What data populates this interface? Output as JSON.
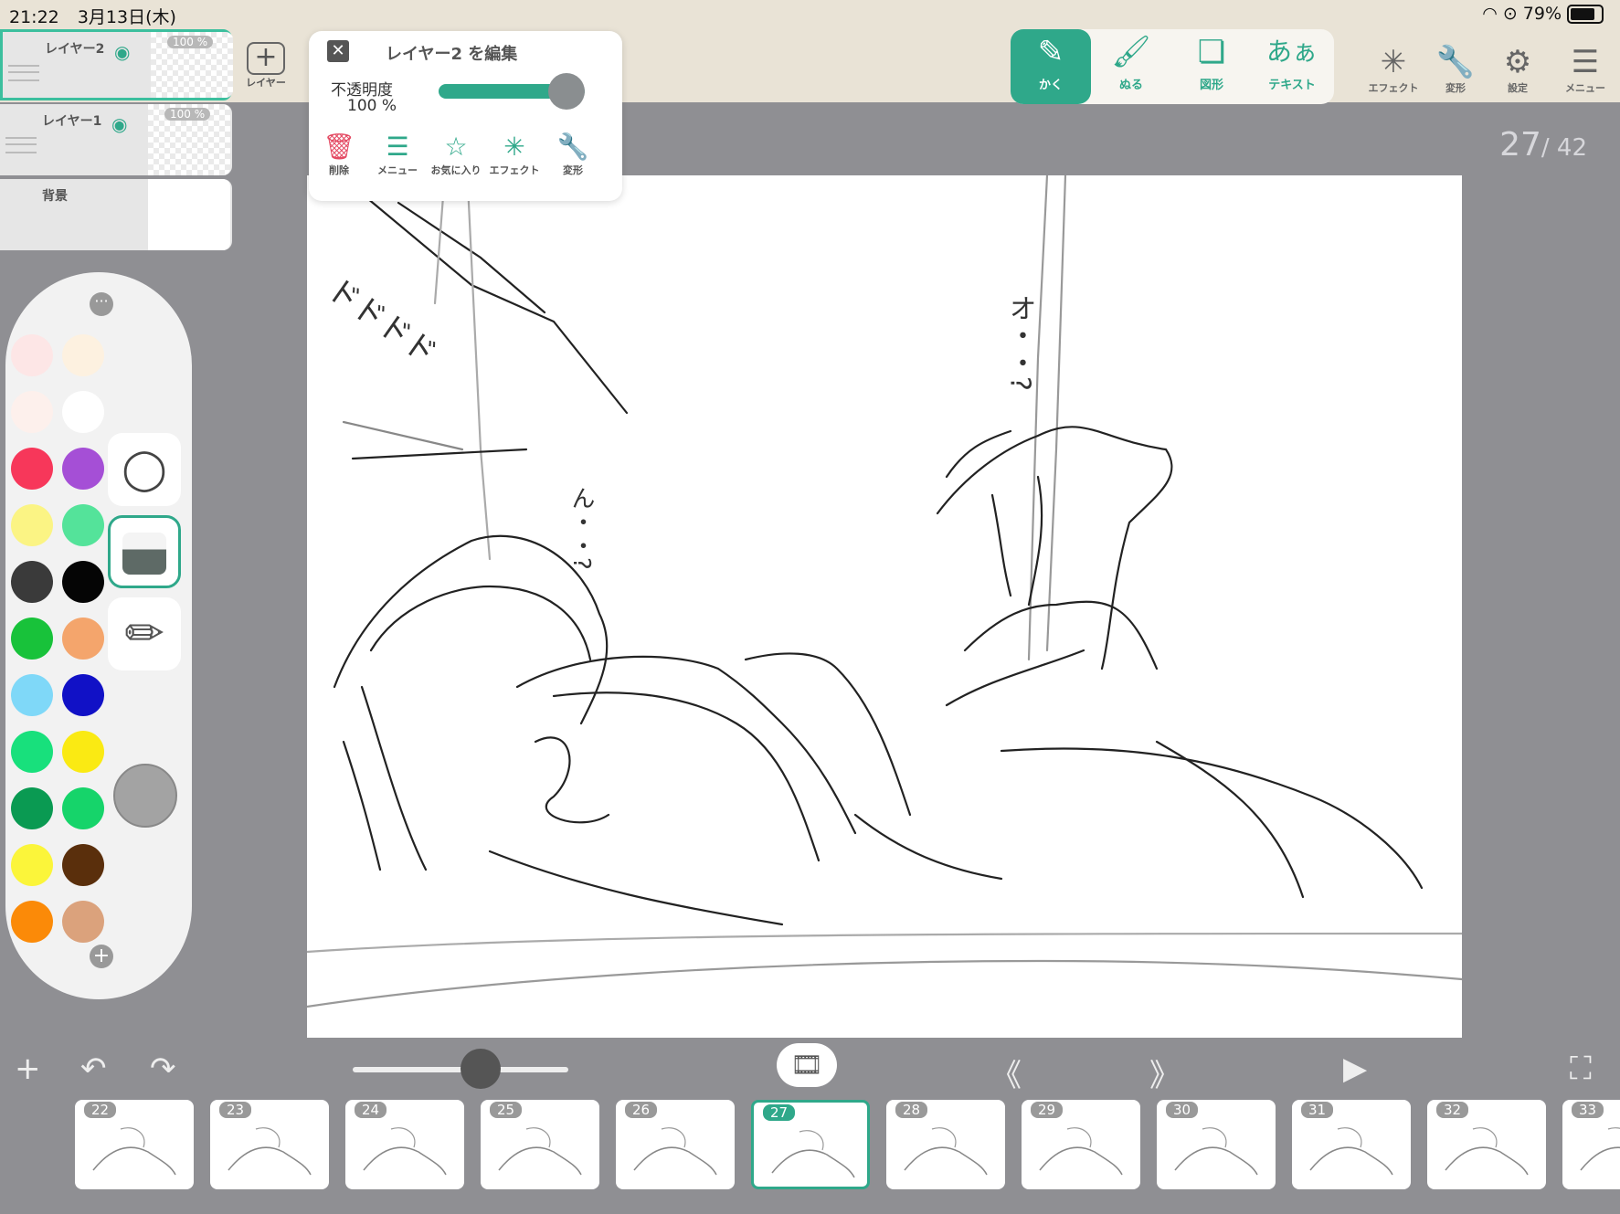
{
  "status": {
    "time": "21:22",
    "date": "3月13日(木)",
    "battery": "79%"
  },
  "layers": [
    {
      "name": "レイヤー2",
      "opacity": "100 %"
    },
    {
      "name": "レイヤー1",
      "opacity": "100 %"
    },
    {
      "name": "背景"
    }
  ],
  "add_layer_label": "レイヤー",
  "edit_popup": {
    "title": "レイヤー2 を編集",
    "opacity_label": "不透明度",
    "opacity_value": "100 %",
    "opacity_level": 1.0,
    "actions": [
      {
        "label": "削除",
        "icon": "trash-icon"
      },
      {
        "label": "メニュー",
        "icon": "menu-icon"
      },
      {
        "label": "お気に入り",
        "icon": "star-icon"
      },
      {
        "label": "エフェクト",
        "icon": "sparkle-icon"
      },
      {
        "label": "変形",
        "icon": "wrench-icon"
      }
    ]
  },
  "tools": [
    {
      "label": "かく",
      "icon": "pen-icon"
    },
    {
      "label": "ぬる",
      "icon": "brush-icon"
    },
    {
      "label": "図形",
      "icon": "shape-icon"
    },
    {
      "label": "テキスト",
      "icon": "text-icon",
      "glyph": "あぁ"
    }
  ],
  "tools_right": [
    {
      "label": "エフェクト",
      "icon": "sparkle-icon"
    },
    {
      "label": "変形",
      "icon": "wrench-icon"
    },
    {
      "label": "設定",
      "icon": "gear-icon"
    },
    {
      "label": "メニュー",
      "icon": "hamburger-icon"
    }
  ],
  "page": {
    "current": "27",
    "total": "/ 42"
  },
  "palette_colors": [
    "#fde6e6",
    "#fdf1e0",
    "#fdf0ec",
    "#ffffff",
    "#f7375a",
    "#a54fd6",
    "#fbf484",
    "#54e39a",
    "#3a3a3a",
    "#050505",
    "#18c23a",
    "#f4a56c",
    "#7fd8f8",
    "#1111c6",
    "#18e07c",
    "#faea13",
    "#0a9a52",
    "#16d46a",
    "#fbf53a",
    "#5a2f0c",
    "#fb8a08",
    "#dba27c"
  ],
  "frames": [
    "22",
    "23",
    "24",
    "25",
    "26",
    "27",
    "28",
    "29",
    "30",
    "31",
    "32",
    "33"
  ],
  "current_frame": "27",
  "canvas_text": {
    "onomatopoeia": "ドドドド",
    "right_sfx": "オ・・?",
    "left_sfx": "ん・・?"
  },
  "accent_color": "#2fa88a"
}
